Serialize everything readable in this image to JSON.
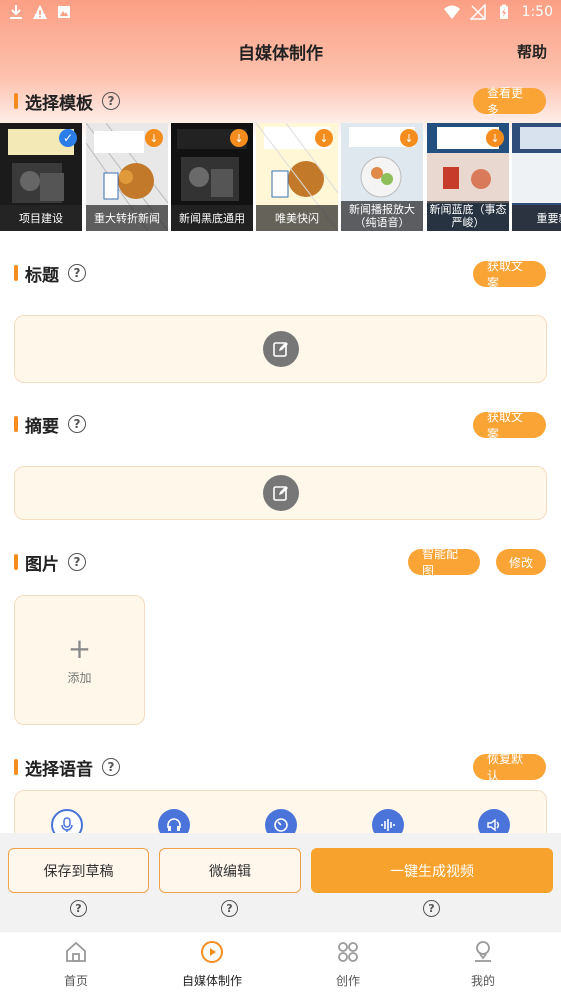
{
  "status_bar": {
    "time": "1:50"
  },
  "header": {
    "title": "自媒体制作",
    "help": "帮助"
  },
  "template_section": {
    "title": "选择模板",
    "more_button": "查看更多",
    "templates": [
      {
        "label": "项目建设",
        "selected": true
      },
      {
        "label": "重大转折新闻",
        "selected": false
      },
      {
        "label": "新闻黑底通用",
        "selected": false
      },
      {
        "label": "唯美快闪",
        "selected": false
      },
      {
        "label": "新闻播报放大（纯语音）",
        "selected": false
      },
      {
        "label": "新闻蓝底（事态严峻）",
        "selected": false
      },
      {
        "label": "重要新",
        "selected": false
      }
    ]
  },
  "title_section": {
    "title": "标题",
    "fetch_button": "获取文案"
  },
  "summary_section": {
    "title": "摘要",
    "fetch_button": "获取文案"
  },
  "image_section": {
    "title": "图片",
    "smart_button": "智能配图",
    "edit_button": "修改",
    "add_label": "添加"
  },
  "voice_section": {
    "title": "选择语音",
    "reset_button": "恢复默认"
  },
  "actions": {
    "save_draft": "保存到草稿",
    "micro_edit": "微编辑",
    "generate": "一键生成视频"
  },
  "bottom_nav": [
    {
      "label": "首页",
      "icon": "home-icon"
    },
    {
      "label": "自媒体制作",
      "icon": "play-circle-icon"
    },
    {
      "label": "创作",
      "icon": "grid-icon"
    },
    {
      "label": "我的",
      "icon": "user-icon"
    }
  ],
  "colors": {
    "accent": "#f58d1e",
    "pill": "#f9a435",
    "primary_button": "#f7a22d",
    "selected_outline": "#2b7de9",
    "nav_active": "#f58d1e"
  }
}
